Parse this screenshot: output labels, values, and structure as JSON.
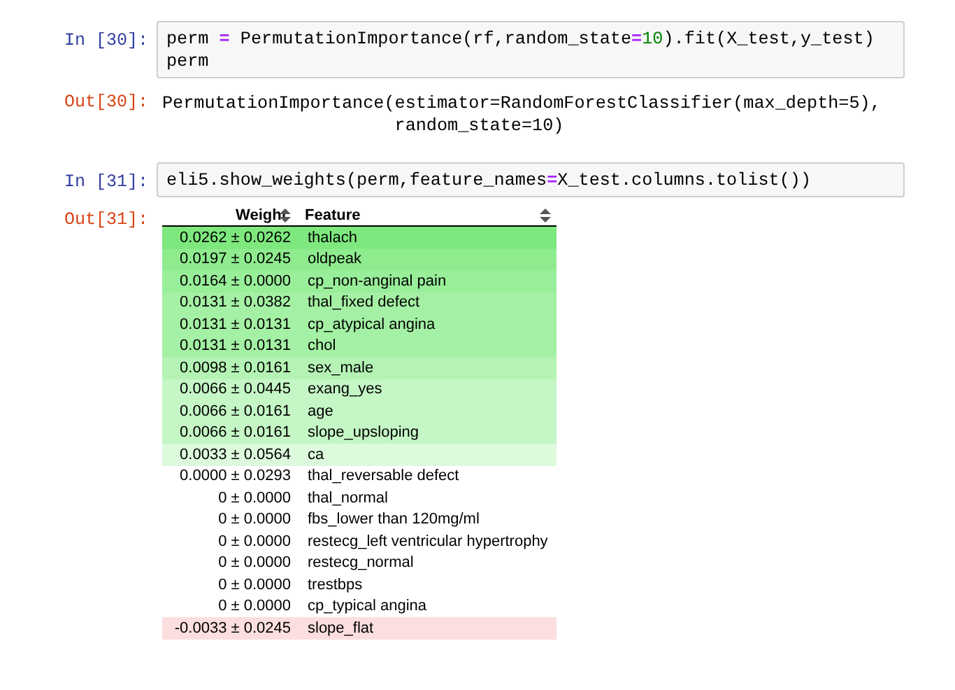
{
  "cells": [
    {
      "kind": "input",
      "prompt": "In [30]:",
      "lines": [
        [
          {
            "kind": "name",
            "text": "perm "
          },
          {
            "kind": "op",
            "text": "="
          },
          {
            "kind": "name",
            "text": " PermutationImportance(rf,random_state"
          },
          {
            "kind": "op",
            "text": "="
          },
          {
            "kind": "num",
            "text": "10"
          },
          {
            "kind": "name",
            "text": ").fit(X_test,y_test)"
          }
        ],
        [
          {
            "kind": "name",
            "text": "perm"
          }
        ]
      ]
    },
    {
      "kind": "output",
      "prompt": "Out[30]:",
      "lines": [
        "PermutationImportance(estimator=RandomForestClassifier(max_depth=5),",
        "                      random_state=10)"
      ]
    },
    {
      "kind": "input",
      "prompt": "In [31]:",
      "lines": [
        [
          {
            "kind": "name",
            "text": "eli5.show_weights(perm,feature_names"
          },
          {
            "kind": "op",
            "text": "="
          },
          {
            "kind": "name",
            "text": "X_test.columns.tolist())"
          }
        ]
      ]
    },
    {
      "kind": "table",
      "prompt": "Out[31]:",
      "columns": [
        "Weight",
        "Feature"
      ],
      "rows": [
        {
          "weight": "0.0262 ± 0.0262",
          "feature": "thalach",
          "color": "#7ee87e"
        },
        {
          "weight": "0.0197 ± 0.0245",
          "feature": "oldpeak",
          "color": "#8eec8e"
        },
        {
          "weight": "0.0164 ± 0.0000",
          "feature": "cp_non-anginal pain",
          "color": "#99ee99"
        },
        {
          "weight": "0.0131 ± 0.0382",
          "feature": "thal_fixed defect",
          "color": "#a4f0a4"
        },
        {
          "weight": "0.0131 ± 0.0131",
          "feature": "cp_atypical angina",
          "color": "#a4f0a4"
        },
        {
          "weight": "0.0131 ± 0.0131",
          "feature": "chol",
          "color": "#a4f0a4"
        },
        {
          "weight": "0.0098 ± 0.0161",
          "feature": "sex_male",
          "color": "#b4f3b4"
        },
        {
          "weight": "0.0066 ± 0.0445",
          "feature": "exang_yes",
          "color": "#c5f6c5"
        },
        {
          "weight": "0.0066 ± 0.0161",
          "feature": "age",
          "color": "#c5f6c5"
        },
        {
          "weight": "0.0066 ± 0.0161",
          "feature": "slope_upsloping",
          "color": "#c5f6c5"
        },
        {
          "weight": "0.0033 ± 0.0564",
          "feature": "ca",
          "color": "#ddfadd"
        },
        {
          "weight": "0.0000 ± 0.0293",
          "feature": "thal_reversable defect",
          "color": "#ffffff"
        },
        {
          "weight": "0 ± 0.0000",
          "feature": "thal_normal",
          "color": "#ffffff"
        },
        {
          "weight": "0 ± 0.0000",
          "feature": "fbs_lower than 120mg/ml",
          "color": "#ffffff"
        },
        {
          "weight": "0 ± 0.0000",
          "feature": "restecg_left ventricular hypertrophy",
          "color": "#ffffff"
        },
        {
          "weight": "0 ± 0.0000",
          "feature": "restecg_normal",
          "color": "#ffffff"
        },
        {
          "weight": "0 ± 0.0000",
          "feature": "trestbps",
          "color": "#ffffff"
        },
        {
          "weight": "0 ± 0.0000",
          "feature": "cp_typical angina",
          "color": "#ffffff"
        },
        {
          "weight": "-0.0033 ± 0.0245",
          "feature": "slope_flat",
          "color": "#fcdede"
        }
      ]
    }
  ]
}
